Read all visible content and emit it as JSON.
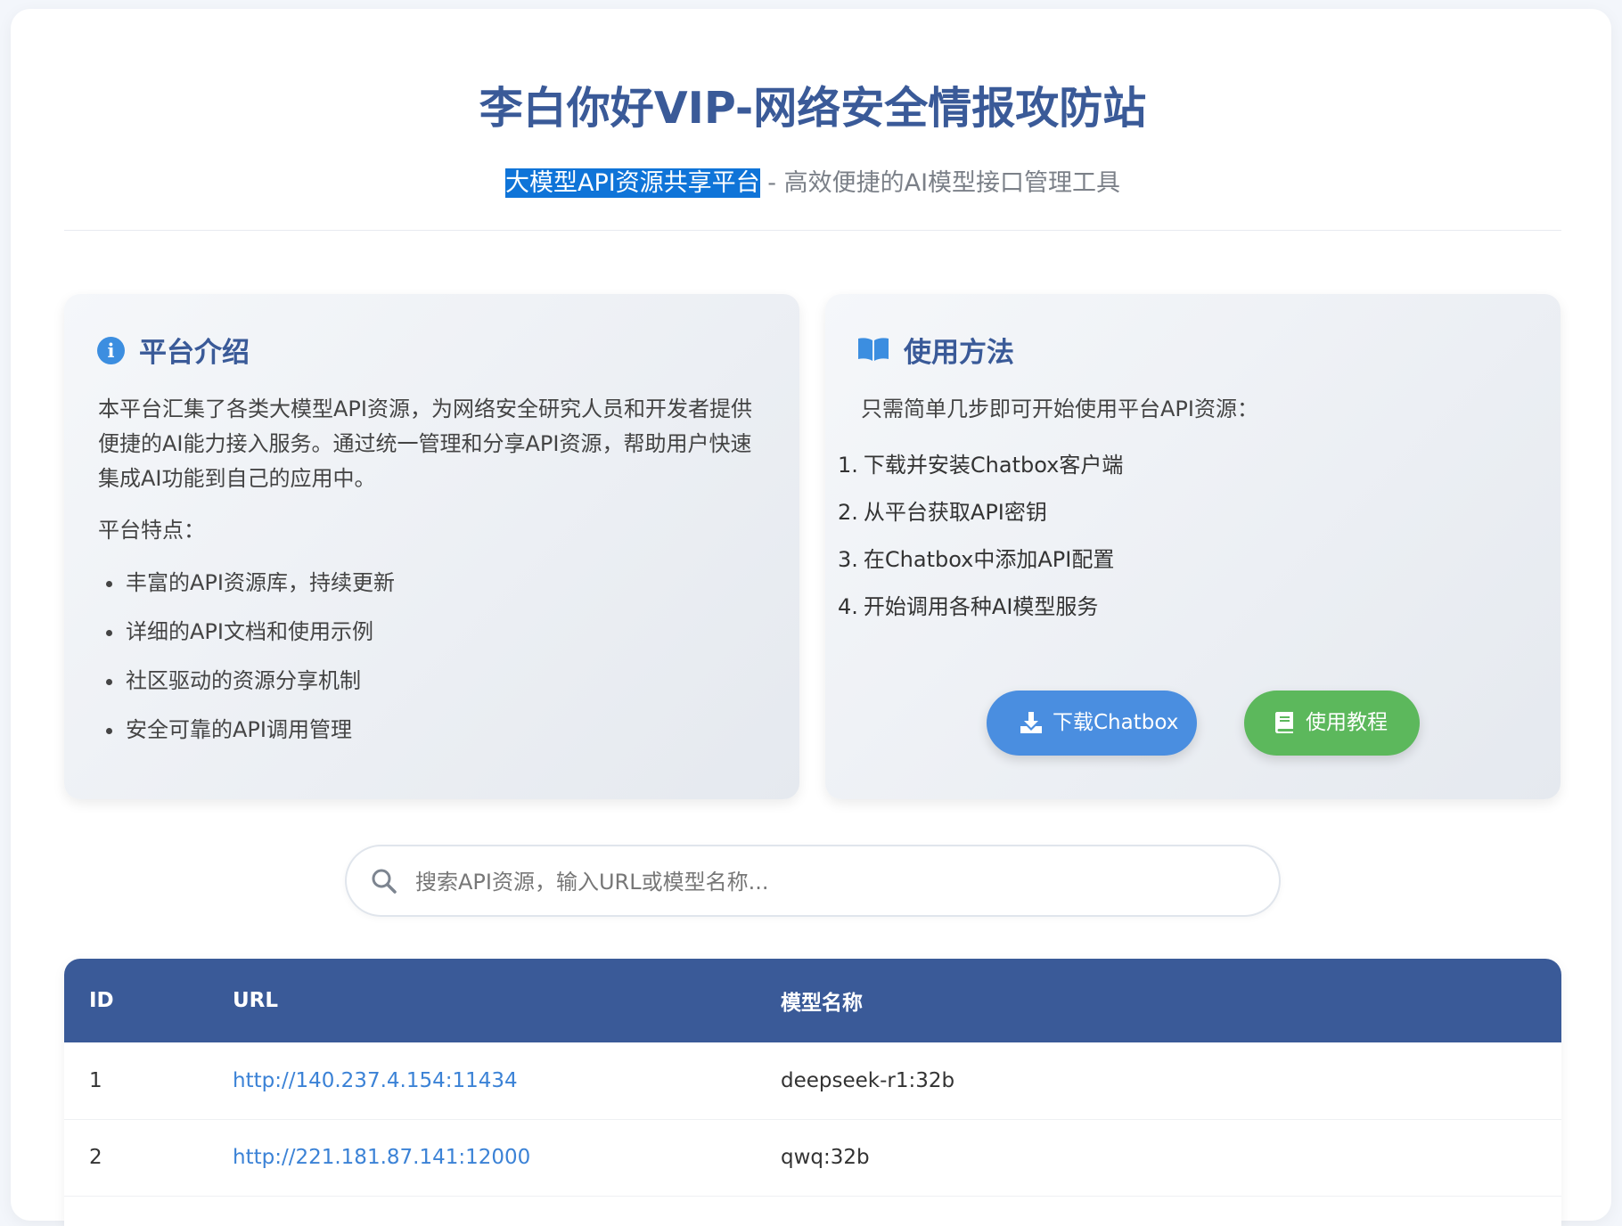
{
  "header": {
    "title": "李白你好VIP-网络安全情报攻防站",
    "subtitle_highlight": "大模型API资源共享平台",
    "subtitle_rest": " - 高效便捷的AI模型接口管理工具"
  },
  "intro": {
    "icon": "info-circle-icon",
    "title": "平台介绍",
    "paragraph": "本平台汇集了各类大模型API资源，为网络安全研究人员和开发者提供便捷的AI能力接入服务。通过统一管理和分享API资源，帮助用户快速集成AI功能到自己的应用中。",
    "features_label": "平台特点：",
    "features": [
      "丰富的API资源库，持续更新",
      "详细的API文档和使用示例",
      "社区驱动的资源分享机制",
      "安全可靠的API调用管理"
    ]
  },
  "usage": {
    "icon": "book-open-icon",
    "title": "使用方法",
    "intro": "只需简单几步即可开始使用平台API资源：",
    "steps": [
      {
        "num": "1.",
        "text": "下载并安装Chatbox客户端"
      },
      {
        "num": "2.",
        "text": "从平台获取API密钥"
      },
      {
        "num": "3.",
        "text": "在Chatbox中添加API配置"
      },
      {
        "num": "4.",
        "text": "开始调用各种AI模型服务"
      }
    ],
    "download_button": "下载Chatbox",
    "tutorial_button": "使用教程"
  },
  "search": {
    "placeholder": "搜索API资源，输入URL或模型名称...",
    "value": ""
  },
  "table": {
    "columns": [
      "ID",
      "URL",
      "模型名称"
    ],
    "rows": [
      {
        "id": "1",
        "url": "http://140.237.4.154:11434",
        "model": "deepseek-r1:32b"
      },
      {
        "id": "2",
        "url": "http://221.181.87.141:12000",
        "model": "qwq:32b"
      }
    ]
  },
  "colors": {
    "primary": "#3a5a98",
    "accent_blue": "#4a8ee0",
    "accent_green": "#5cb85c",
    "link": "#3b82d6",
    "selection": "#0f74d8"
  }
}
